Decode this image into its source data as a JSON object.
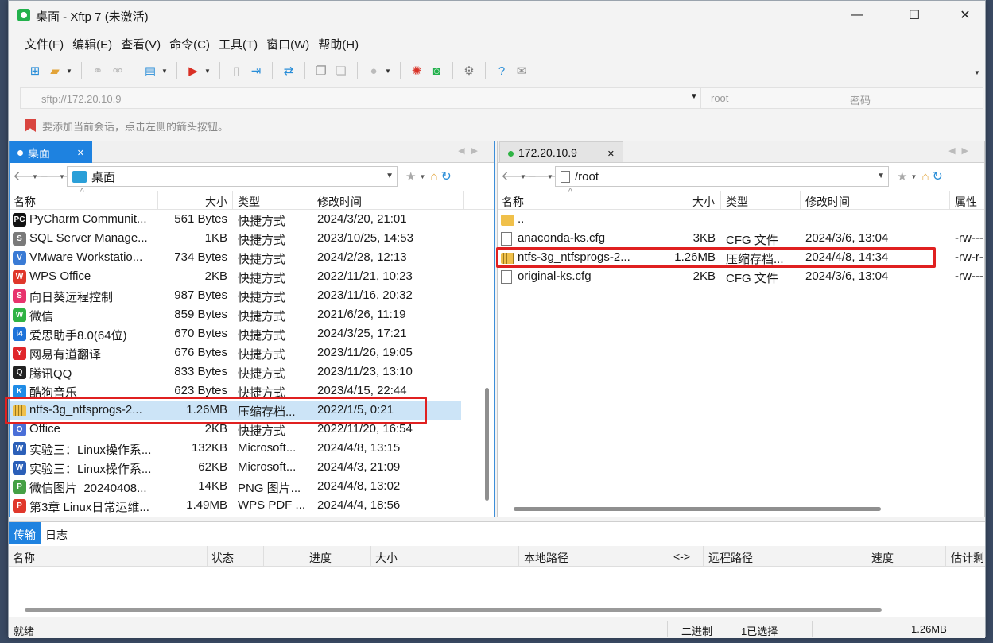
{
  "window": {
    "title": "桌面 - Xftp 7 (未激活)",
    "minimize": "—",
    "maximize": "☐",
    "close": "✕"
  },
  "menu": [
    "文件(F)",
    "编辑(E)",
    "查看(V)",
    "命令(C)",
    "工具(T)",
    "窗口(W)",
    "帮助(H)"
  ],
  "address": {
    "host_placeholder": "sftp://172.20.10.9",
    "user_placeholder": "root",
    "password_placeholder": "密码"
  },
  "hint": "要添加当前会话，点击左侧的箭头按钮。",
  "left": {
    "tab": "桌面",
    "path": "桌面",
    "columns": [
      "名称",
      "大小",
      "类型",
      "修改时间"
    ],
    "files": [
      {
        "name": "PyCharm Communit...",
        "size": "561 Bytes",
        "type": "快捷方式",
        "modified": "2024/3/20, 21:01",
        "icon": "pycharm-icon",
        "color": "#111111",
        "glyph": "PC"
      },
      {
        "name": "SQL Server Manage...",
        "size": "1KB",
        "type": "快捷方式",
        "modified": "2023/10/25, 14:53",
        "icon": "sql-server-icon",
        "color": "#7a7a7a",
        "glyph": "S"
      },
      {
        "name": "VMware Workstatio...",
        "size": "734 Bytes",
        "type": "快捷方式",
        "modified": "2024/2/28, 12:13",
        "icon": "vmware-icon",
        "color": "#3a7bd5",
        "glyph": "V"
      },
      {
        "name": "WPS Office",
        "size": "2KB",
        "type": "快捷方式",
        "modified": "2022/11/21, 10:23",
        "icon": "wps-icon",
        "color": "#e0372b",
        "glyph": "W"
      },
      {
        "name": "向日葵远程控制",
        "size": "987 Bytes",
        "type": "快捷方式",
        "modified": "2023/11/16, 20:32",
        "icon": "sunlogin-icon",
        "color": "#e8336d",
        "glyph": "S"
      },
      {
        "name": "微信",
        "size": "859 Bytes",
        "type": "快捷方式",
        "modified": "2021/6/26, 11:19",
        "icon": "wechat-icon",
        "color": "#2fb344",
        "glyph": "W"
      },
      {
        "name": "爱思助手8.0(64位)",
        "size": "670 Bytes",
        "type": "快捷方式",
        "modified": "2024/3/25, 17:21",
        "icon": "i4-icon",
        "color": "#1e73d9",
        "glyph": "i4"
      },
      {
        "name": "网易有道翻译",
        "size": "676 Bytes",
        "type": "快捷方式",
        "modified": "2023/11/26, 19:05",
        "icon": "youdao-icon",
        "color": "#e0262b",
        "glyph": "Y"
      },
      {
        "name": "腾讯QQ",
        "size": "833 Bytes",
        "type": "快捷方式",
        "modified": "2023/11/23, 13:10",
        "icon": "qq-icon",
        "color": "#222222",
        "glyph": "Q"
      },
      {
        "name": "酷狗音乐",
        "size": "623 Bytes",
        "type": "快捷方式",
        "modified": "2023/4/15, 22:44",
        "icon": "kugou-icon",
        "color": "#1f8be6",
        "glyph": "K"
      },
      {
        "name": "ntfs-3g_ntfsprogs-2...",
        "size": "1.26MB",
        "type": "压缩存档...",
        "modified": "2022/1/5, 0:21",
        "icon": "archive-icon",
        "color": "#e9b832",
        "glyph": "Z"
      },
      {
        "name": "Office",
        "size": "2KB",
        "type": "快捷方式",
        "modified": "2022/11/20, 16:54",
        "icon": "office-icon",
        "color": "#4a6fd8",
        "glyph": "O"
      },
      {
        "name": "实验三：Linux操作系...",
        "size": "132KB",
        "type": "Microsoft...",
        "modified": "2024/4/8, 13:15",
        "icon": "word-doc-icon",
        "color": "#2b5fb8",
        "glyph": "W"
      },
      {
        "name": "实验三：Linux操作系...",
        "size": "62KB",
        "type": "Microsoft...",
        "modified": "2024/4/3, 21:09",
        "icon": "word-doc-icon",
        "color": "#2b5fb8",
        "glyph": "W"
      },
      {
        "name": "微信图片_20240408...",
        "size": "14KB",
        "type": "PNG 图片...",
        "modified": "2024/4/8, 13:02",
        "icon": "image-file-icon",
        "color": "#45a045",
        "glyph": "P"
      },
      {
        "name": "第3章 Linux日常运维...",
        "size": "1.49MB",
        "type": "WPS PDF ...",
        "modified": "2024/4/4, 18:56",
        "icon": "pdf-icon",
        "color": "#e0372b",
        "glyph": "P"
      }
    ]
  },
  "right": {
    "tab": "172.20.10.9",
    "path": "/root",
    "columns": [
      "名称",
      "大小",
      "类型",
      "修改时间",
      "属性"
    ],
    "files": [
      {
        "name": "..",
        "size": "",
        "type": "",
        "modified": "",
        "perm": "",
        "icon": "parent-folder-icon"
      },
      {
        "name": "anaconda-ks.cfg",
        "size": "3KB",
        "type": "CFG 文件",
        "modified": "2024/3/6, 13:04",
        "perm": "-rw---",
        "icon": "file-icon"
      },
      {
        "name": "ntfs-3g_ntfsprogs-2...",
        "size": "1.26MB",
        "type": "压缩存档...",
        "modified": "2024/4/8, 14:34",
        "perm": "-rw-r-",
        "icon": "archive-icon"
      },
      {
        "name": "original-ks.cfg",
        "size": "2KB",
        "type": "CFG 文件",
        "modified": "2024/3/6, 13:04",
        "perm": "-rw---",
        "icon": "file-icon"
      }
    ]
  },
  "transfer": {
    "tabs": [
      "传输",
      "日志"
    ],
    "columns": [
      "名称",
      "状态",
      "进度",
      "大小",
      "本地路径",
      "<->",
      "远程路径",
      "速度",
      "估计剩"
    ]
  },
  "status": {
    "left": "就绪",
    "mode": "二进制",
    "selection": "1已选择",
    "size": "1.26MB"
  },
  "colors": {
    "accent": "#1e82e0",
    "highlight": "#e02020",
    "selected_row": "#cce4f7"
  }
}
